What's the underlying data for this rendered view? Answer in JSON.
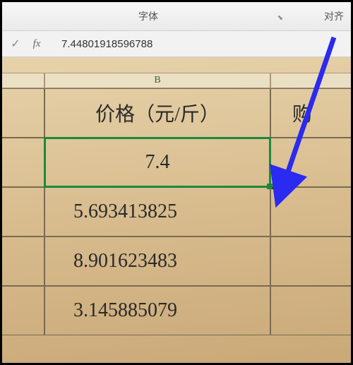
{
  "ribbon": {
    "font_group": "字体",
    "align_group": "对齐"
  },
  "formula_bar": {
    "confirm_icon": "✓",
    "fx_label": "fx",
    "value": "7.44801918596788"
  },
  "column_header": {
    "b": "B"
  },
  "header_row": {
    "b": "价格（元/斤）",
    "c": "购"
  },
  "rows": [
    {
      "b": "7.4"
    },
    {
      "b": "5.693413825"
    },
    {
      "b": "8.901623483"
    },
    {
      "b": "3.145885079"
    }
  ],
  "arrow_color": "#2a2af0"
}
